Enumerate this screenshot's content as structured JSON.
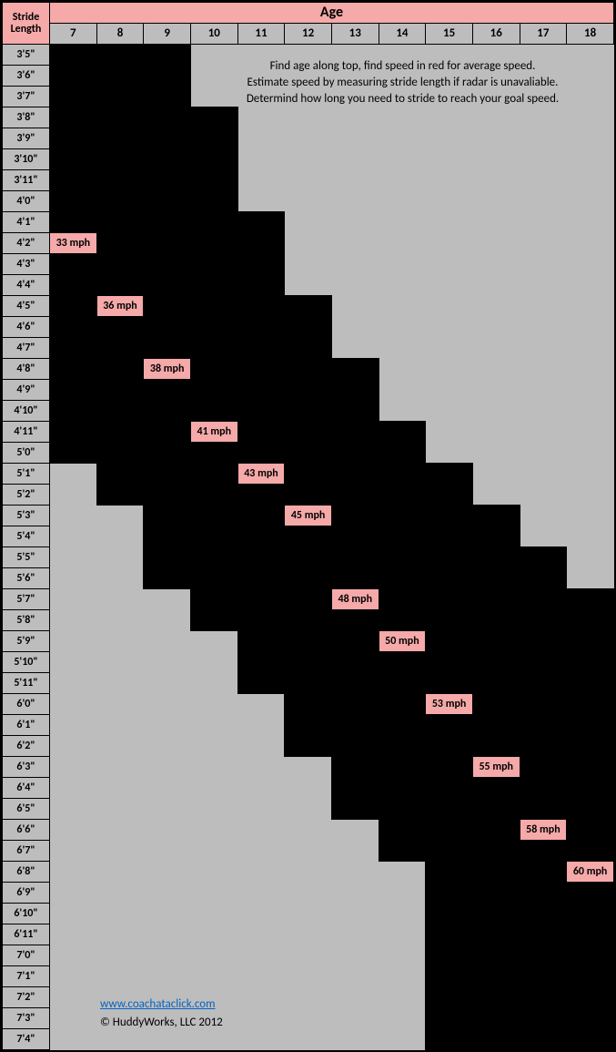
{
  "header": {
    "corner_l1": "Stride",
    "corner_l2": "Length",
    "age_label": "Age"
  },
  "instructions": {
    "l1": "Find age along top, find speed in red for average speed.",
    "l2": "Estimate speed by measuring stride length if radar is unavaliable.",
    "l3": "Determind how long you need to stride to reach your goal speed."
  },
  "footer": {
    "link_text": "www.coachataclick.com",
    "link_href": "http://www.coachataclick.com",
    "copyright": "© HuddyWorks, LLC 2012"
  },
  "chart_data": {
    "type": "table",
    "title": "Stride Length vs Age — Average Speed (mph)",
    "xlabel": "Age",
    "ylabel": "Stride Length",
    "ages": [
      7,
      8,
      9,
      10,
      11,
      12,
      13,
      14,
      15,
      16,
      17,
      18
    ],
    "stride_labels": [
      "3'5\"",
      "3'6\"",
      "3'7\"",
      "3'8\"",
      "3'9\"",
      "3'10\"",
      "3'11\"",
      "4'0\"",
      "4'1\"",
      "4'2\"",
      "4'3\"",
      "4'4\"",
      "4'5\"",
      "4'6\"",
      "4'7\"",
      "4'8\"",
      "4'9\"",
      "4'10\"",
      "4'11\"",
      "5'0\"",
      "5'1\"",
      "5'2\"",
      "5'3\"",
      "5'4\"",
      "5'5\"",
      "5'6\"",
      "5'7\"",
      "5'8\"",
      "5'9\"",
      "5'10\"",
      "5'11\"",
      "6'0\"",
      "6'1\"",
      "6'2\"",
      "6'3\"",
      "6'4\"",
      "6'5\"",
      "6'6\"",
      "6'7\"",
      "6'8\"",
      "6'9\"",
      "6'10\"",
      "6'11\"",
      "7'0\"",
      "7'1\"",
      "7'2\"",
      "7'3\"",
      "7'4\""
    ],
    "age_ranges": {
      "7": [
        0,
        19
      ],
      "8": [
        0,
        21
      ],
      "9": [
        0,
        25
      ],
      "10": [
        3,
        27
      ],
      "11": [
        8,
        30
      ],
      "12": [
        12,
        33
      ],
      "13": [
        15,
        36
      ],
      "14": [
        18,
        38
      ],
      "15": [
        20,
        47
      ],
      "16": [
        22,
        47
      ],
      "17": [
        24,
        47
      ],
      "18": [
        26,
        47
      ]
    },
    "highlights": [
      {
        "age": 7,
        "stride": "4'2\"",
        "value": "33 mph"
      },
      {
        "age": 8,
        "stride": "4'5\"",
        "value": "36 mph"
      },
      {
        "age": 9,
        "stride": "4'8\"",
        "value": "38 mph"
      },
      {
        "age": 10,
        "stride": "4'11\"",
        "value": "41 mph"
      },
      {
        "age": 11,
        "stride": "5'1\"",
        "value": "43 mph"
      },
      {
        "age": 12,
        "stride": "5'3\"",
        "value": "45 mph"
      },
      {
        "age": 13,
        "stride": "5'7\"",
        "value": "48 mph"
      },
      {
        "age": 14,
        "stride": "5'9\"",
        "value": "50 mph"
      },
      {
        "age": 15,
        "stride": "6'0\"",
        "value": "53 mph"
      },
      {
        "age": 16,
        "stride": "6'3\"",
        "value": "55 mph"
      },
      {
        "age": 17,
        "stride": "6'6\"",
        "value": "58 mph"
      },
      {
        "age": 18,
        "stride": "6'8\"",
        "value": "60 mph"
      }
    ]
  }
}
